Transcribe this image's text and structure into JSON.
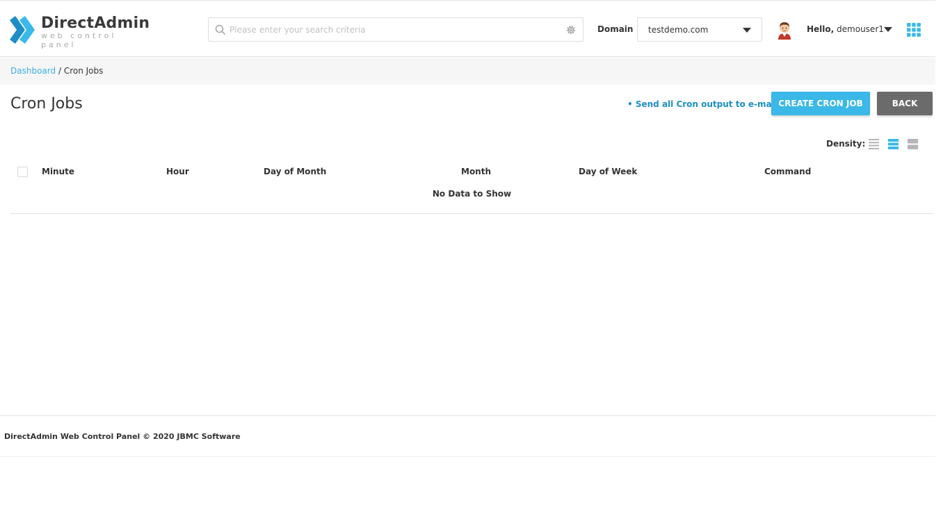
{
  "header": {
    "logo_title": "DirectAdmin",
    "logo_subtitle": "web control panel",
    "search_placeholder": "Please enter your search criteria",
    "domain_label": "Domain",
    "domain_value": "testdemo.com",
    "greeting": "Hello,",
    "username": "demouser1"
  },
  "breadcrumb": {
    "home": "Dashboard",
    "separator": "/",
    "current": "Cron Jobs"
  },
  "page": {
    "title": "Cron Jobs",
    "send_link": "• Send all Cron output to e-mail",
    "create_button": "CREATE CRON JOB",
    "back_button": "BACK",
    "density_label": "Density:"
  },
  "table": {
    "columns": [
      "Minute",
      "Hour",
      "Day of Month",
      "Month",
      "Day of Week",
      "Command"
    ],
    "empty_text": "No Data to Show"
  },
  "footer": {
    "text": "DirectAdmin Web Control Panel © 2020 JBMC Software"
  },
  "colors": {
    "accent": "#3ab8e8",
    "link": "#1b8fc4",
    "back_button": "#6b6b6b"
  },
  "icons": [
    "directadmin-logo-icon",
    "search-icon",
    "gear-icon",
    "caret-down-icon",
    "user-avatar-icon",
    "apps-grid-icon",
    "density-compact-icon",
    "density-normal-icon",
    "density-comfortable-icon"
  ]
}
